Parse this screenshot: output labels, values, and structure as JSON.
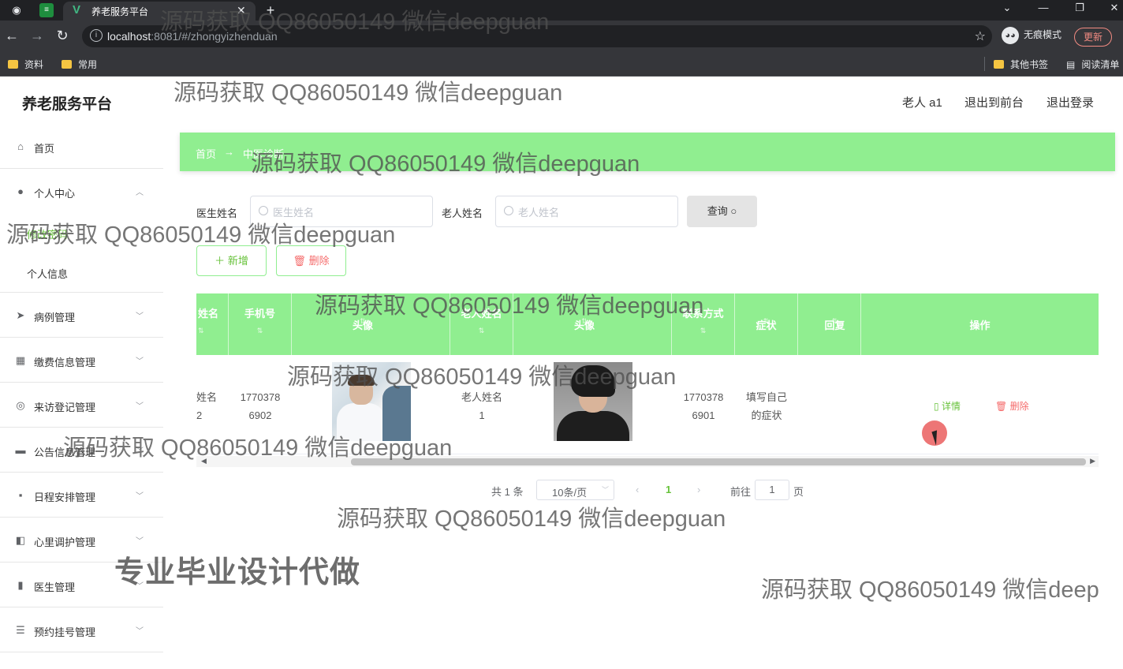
{
  "browser": {
    "tab_title": "养老服务平台",
    "url_host": "localhost",
    "url_rest": ":8081/#/zhongyizhenduan",
    "incognito_label": "无痕模式",
    "update_label": "更新",
    "bookmarks": [
      "资料",
      "常用"
    ],
    "bookmarks_right": [
      "其他书签",
      "阅读清单"
    ]
  },
  "app": {
    "logo": "养老服务平台",
    "top_links": [
      "老人 a1",
      "退出到前台",
      "退出登录"
    ]
  },
  "sidebar": {
    "items": [
      {
        "label": "首页",
        "icon": "home-icon"
      },
      {
        "label": "个人中心",
        "icon": "user-icon"
      },
      {
        "label": "病例管理",
        "icon": "send-icon"
      },
      {
        "label": "缴费信息管理",
        "icon": "grid-icon"
      },
      {
        "label": "来访登记管理",
        "icon": "register-icon"
      },
      {
        "label": "公告信息管理",
        "icon": "ticket-icon"
      },
      {
        "label": "日程安排管理",
        "icon": "chat-icon"
      },
      {
        "label": "心里调护管理",
        "icon": "care-icon"
      },
      {
        "label": "医生管理",
        "icon": "bar-chart-icon"
      },
      {
        "label": "预约挂号管理",
        "icon": "list-icon"
      }
    ],
    "sub_items": [
      "修改密码",
      "个人信息"
    ]
  },
  "breadcrumb": {
    "home": "首页",
    "arrow": "→",
    "current": "中医诊断"
  },
  "search": {
    "doctor_label": "医生姓名",
    "doctor_placeholder": "医生姓名",
    "elder_label": "老人姓名",
    "elder_placeholder": "老人姓名",
    "query_label": "查询"
  },
  "actions": {
    "add": "新增",
    "delete": "删除"
  },
  "table": {
    "headers": [
      "姓名",
      "手机号",
      "头像",
      "老人姓名",
      "头像",
      "联系方式",
      "症状",
      "回复",
      "操作"
    ],
    "row": {
      "doctor_name": [
        "姓名",
        "2"
      ],
      "phone": [
        "1770378",
        "6902"
      ],
      "elder_name": [
        "老人姓名",
        "1"
      ],
      "contact": [
        "1770378",
        "6901"
      ],
      "symptom": [
        "填写自己",
        "的症状"
      ],
      "detail": "详情",
      "delete": "删除"
    }
  },
  "pagination": {
    "total": "共 1 条",
    "page_size": "10条/页",
    "current_page": "1",
    "goto_label": "前往",
    "goto_value": "1",
    "page_unit": "页"
  },
  "watermarks": {
    "text": "源码获取 QQ86050149 微信deepguan",
    "text_cut": "源码获取 QQ86050149 微信deep",
    "banner": "专业毕业设计代做"
  },
  "colors": {
    "accent": "#90ee90",
    "danger": "#f56c6c",
    "success": "#67c23a"
  }
}
